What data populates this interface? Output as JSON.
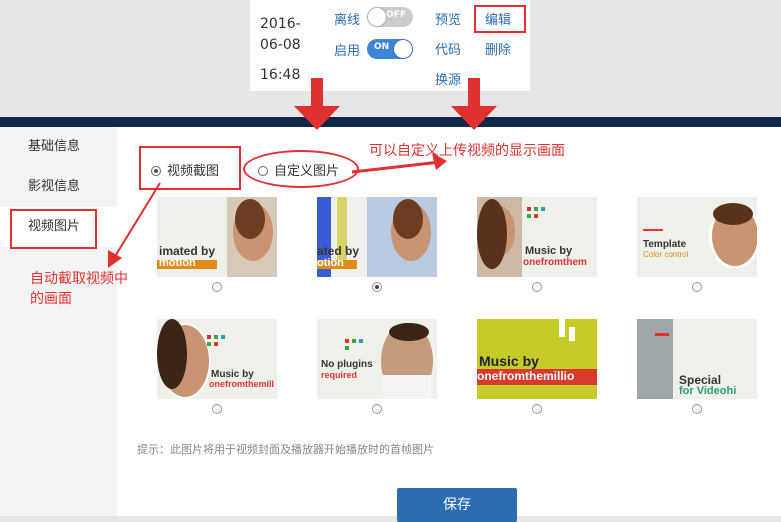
{
  "row": {
    "date_line1": "2016-",
    "date_line2": "06-08",
    "time": "16:48",
    "offline_label": "离线",
    "offline_toggle": "OFF",
    "enable_label": "启用",
    "enable_toggle": "ON",
    "actions": {
      "preview": "预览",
      "edit": "编辑",
      "code": "代码",
      "delete": "删除",
      "replace": "换源"
    }
  },
  "sidebar": {
    "items": [
      {
        "label": "基础信息"
      },
      {
        "label": "影视信息"
      },
      {
        "label": "视频图片"
      }
    ]
  },
  "main": {
    "radio_screenshot": "视频截图",
    "radio_custom": "自定义图片",
    "hint": "提示：此图片将用于视频封面及播放器开始播放时的首帧图片",
    "save": "保存"
  },
  "thumbnails": [
    {
      "line1": "imated by",
      "line2": "motion",
      "selected": false
    },
    {
      "line1": "ated by",
      "line2": "otion",
      "selected": true
    },
    {
      "line1": "Music by",
      "line2": "onefromthem",
      "selected": false
    },
    {
      "line1": "Template",
      "line2": "Color control",
      "selected": false
    },
    {
      "line1": "Music by",
      "line2": "onefromthemill",
      "selected": false
    },
    {
      "line1": "No plugins",
      "line2": "required",
      "selected": false
    },
    {
      "line1": "Music by",
      "line2": "onefromthemillio",
      "selected": false
    },
    {
      "line1": "Special",
      "line2": "for Videohi",
      "selected": false
    }
  ],
  "annotations": {
    "custom_note": "可以自定义上传视频的显示画面",
    "auto_note_line1": "自动截取视频中",
    "auto_note_line2": "的画面"
  },
  "colors": {
    "annotation_red": "#e03030",
    "link_blue": "#2a6db0",
    "navy": "#12284a",
    "toggle_on": "#3d85d6"
  }
}
